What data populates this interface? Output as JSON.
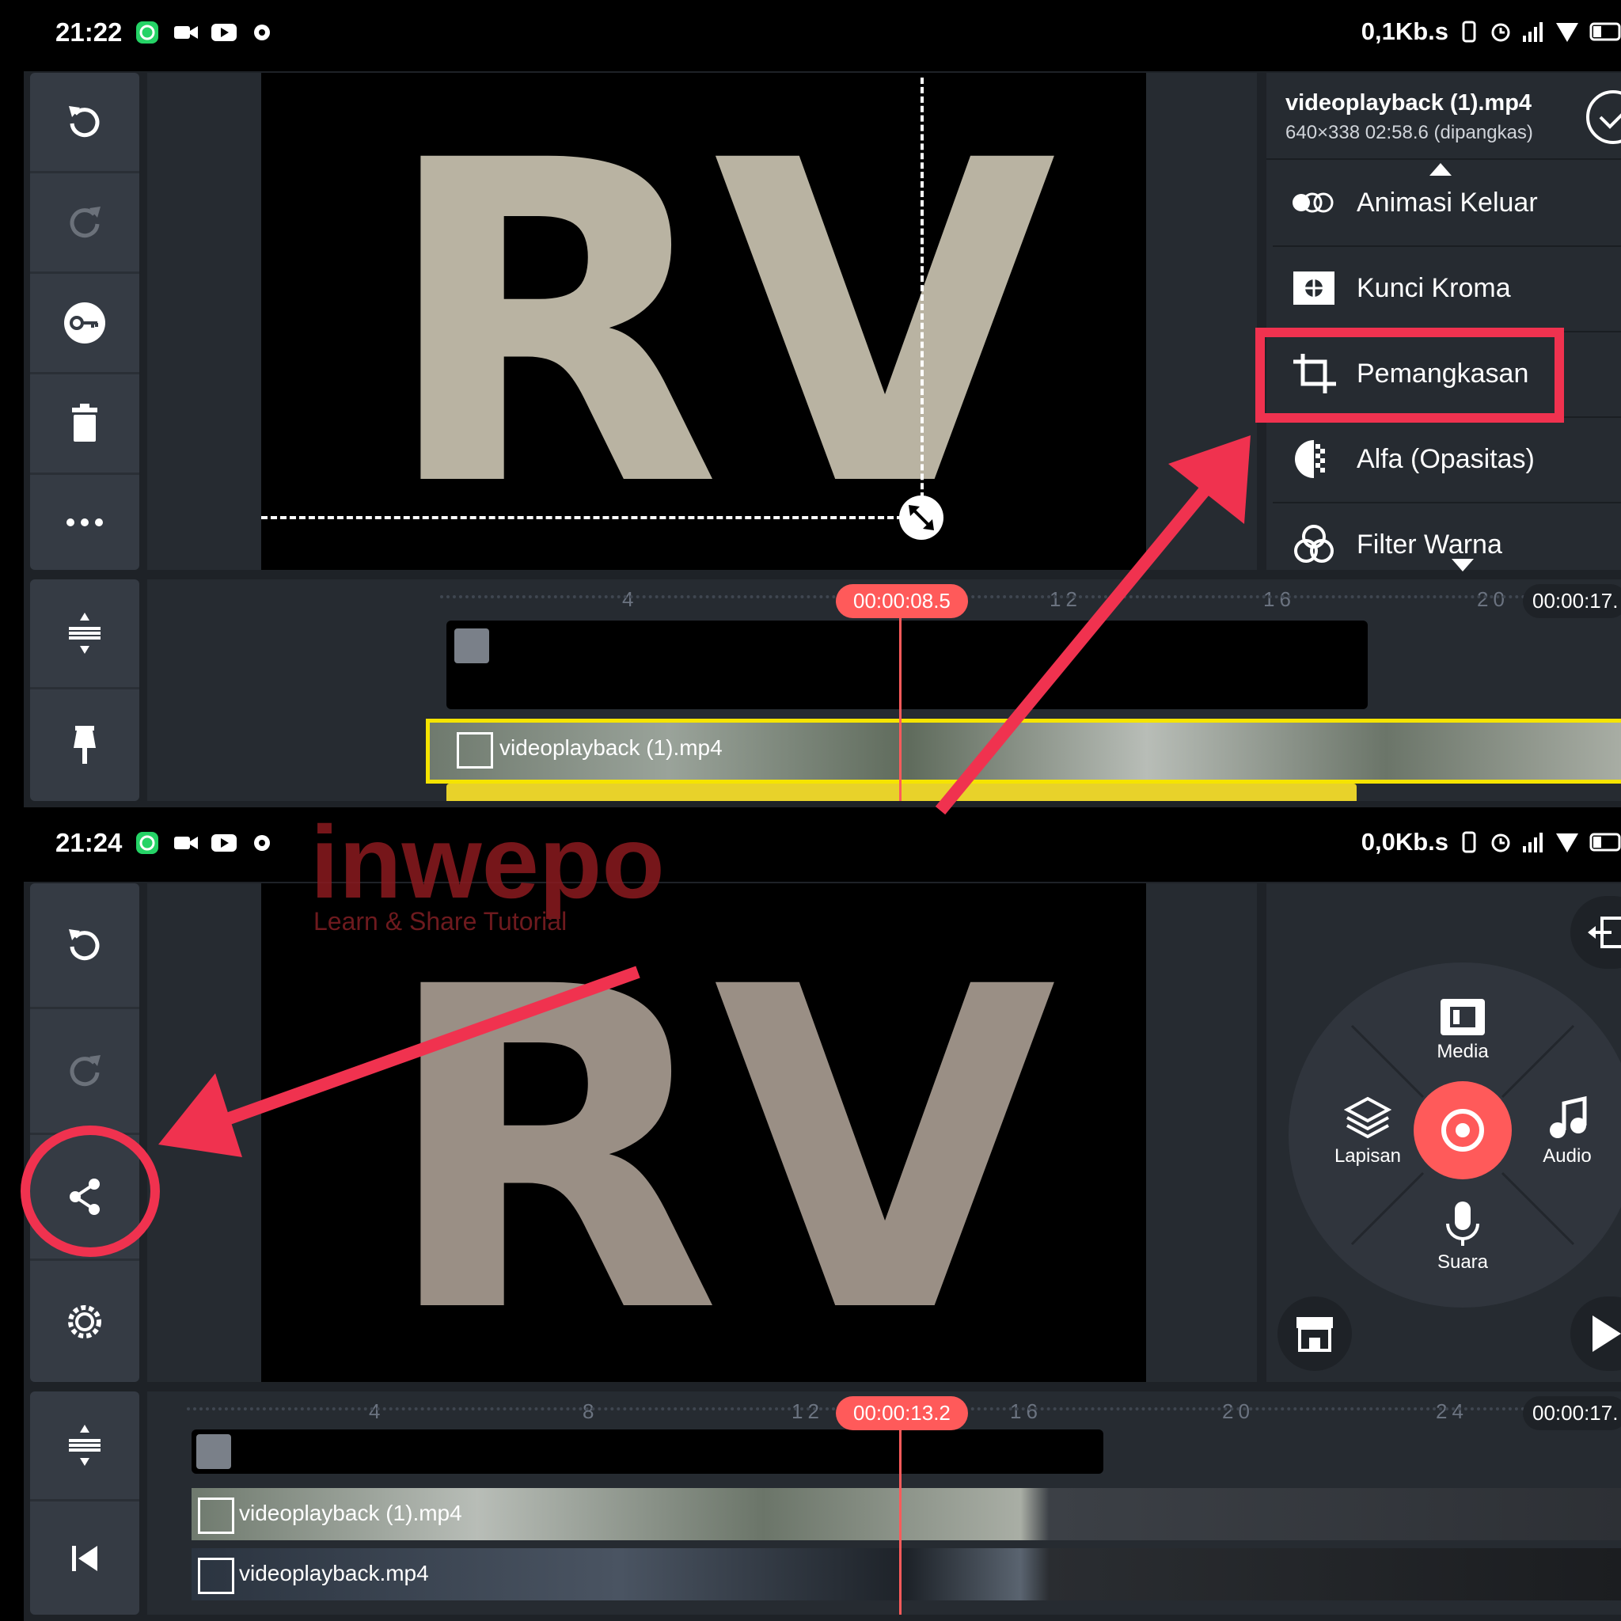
{
  "top": {
    "status": {
      "time": "21:22",
      "speed": "0,1Kb.s"
    },
    "clip": {
      "title": "videoplayback (1).mp4",
      "info": "640×338  02:58.6 (dipangkas)"
    },
    "menu": [
      {
        "label": "Animasi Keluar",
        "icon": "circles-fade-icon"
      },
      {
        "label": "Kunci Kroma",
        "icon": "chroma-key-icon"
      },
      {
        "label": "Pemangkasan",
        "icon": "crop-icon"
      },
      {
        "label": "Alfa (Opasitas)",
        "icon": "opacity-icon"
      },
      {
        "label": "Filter Warna",
        "icon": "color-filter-icon"
      }
    ],
    "preview_text": "RV",
    "timeline": {
      "ruler": [
        "4",
        "12",
        "16",
        "20"
      ],
      "playhead_time": "00:00:08.5",
      "end_time": "00:00:17.",
      "video_clip_label": "videoplayback (1).mp4"
    }
  },
  "bottom": {
    "status": {
      "time": "21:24",
      "speed": "0,0Kb.s"
    },
    "watermark": {
      "title": "inwepo",
      "subtitle": "Learn & Share Tutorial"
    },
    "preview_text": "RV",
    "wheel": {
      "media": "Media",
      "layer": "Lapisan",
      "audio": "Audio",
      "voice": "Suara"
    },
    "timeline": {
      "ruler": [
        "4",
        "8",
        "12",
        "16",
        "20",
        "24"
      ],
      "playhead_time": "00:00:13.2",
      "end_time": "00:00:17.",
      "clip1_label": "videoplayback (1).mp4",
      "clip2_label": "videoplayback.mp4"
    }
  },
  "colors": {
    "accent": "#ff5a5a",
    "highlight": "#f0324f",
    "selection": "#f5e400"
  }
}
